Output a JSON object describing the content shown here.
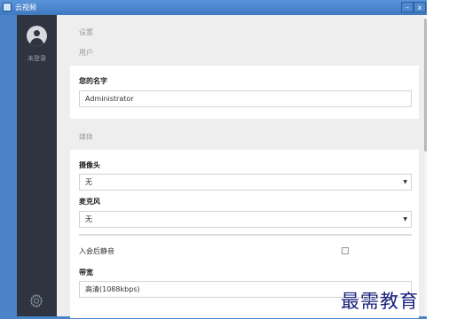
{
  "window": {
    "title": "云视频",
    "minimize_label": "–",
    "close_label": "x"
  },
  "sidebar": {
    "login_status": "未登录",
    "avatar_icon": "user-avatar-icon",
    "settings_icon": "gear-icon"
  },
  "main": {
    "settings_header": "设置",
    "user_section": "用户",
    "name_label": "您的名字",
    "name_value": "Administrator",
    "media_section": "媒体",
    "camera_label": "摄像头",
    "camera_value": "无",
    "mic_label": "麦克风",
    "mic_value": "无",
    "mute_on_join_label": "入会后静音",
    "bandwidth_label": "带宽",
    "bandwidth_value": "高清(1088kbps)"
  },
  "watermark": "最需教育"
}
